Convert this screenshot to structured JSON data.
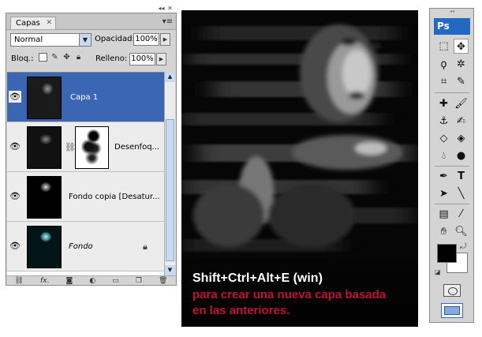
{
  "layers_panel": {
    "tab_label": "Capas",
    "blend_mode": "Normal",
    "opacity_label": "Opacidad:",
    "opacity_value": "100%",
    "lock_label": "Bloq.:",
    "fill_label": "Relleno:",
    "fill_value": "100%",
    "layers": [
      {
        "name": "Capa 1",
        "selected": true
      },
      {
        "name": "Desenfoq...",
        "selected": false
      },
      {
        "name": "Fondo copia [Desatur...",
        "selected": false
      },
      {
        "name": "Fondo",
        "selected": false,
        "italic": true,
        "locked": true
      }
    ],
    "bottom_icons": [
      "link-icon",
      "fx-icon",
      "add-mask-icon",
      "adjustment-icon",
      "group-icon",
      "new-layer-icon",
      "trash-icon"
    ]
  },
  "canvas": {
    "caption_line1": "Shift+Ctrl+Alt+E (win)",
    "caption_line2": "para crear una nueva capa basada",
    "caption_line3": "en las anteriores.",
    "caption_color_primary": "#ffffff",
    "caption_color_accent": "#c01234"
  },
  "tools_panel": {
    "logo": "Ps",
    "foreground_color": "#000000",
    "background_color": "#ffffff",
    "tools": [
      "marquee",
      "move",
      "lasso",
      "magic-wand",
      "crop",
      "slice",
      "healing",
      "brush",
      "stamp",
      "history-brush",
      "eraser",
      "paint-bucket",
      "blur",
      "dodge",
      "pen",
      "type",
      "path-selection",
      "line",
      "notes",
      "eyedropper",
      "hand",
      "zoom"
    ]
  },
  "colors": {
    "selection_blue": "#3a66b3",
    "panel_gray": "#d4d4d4"
  }
}
